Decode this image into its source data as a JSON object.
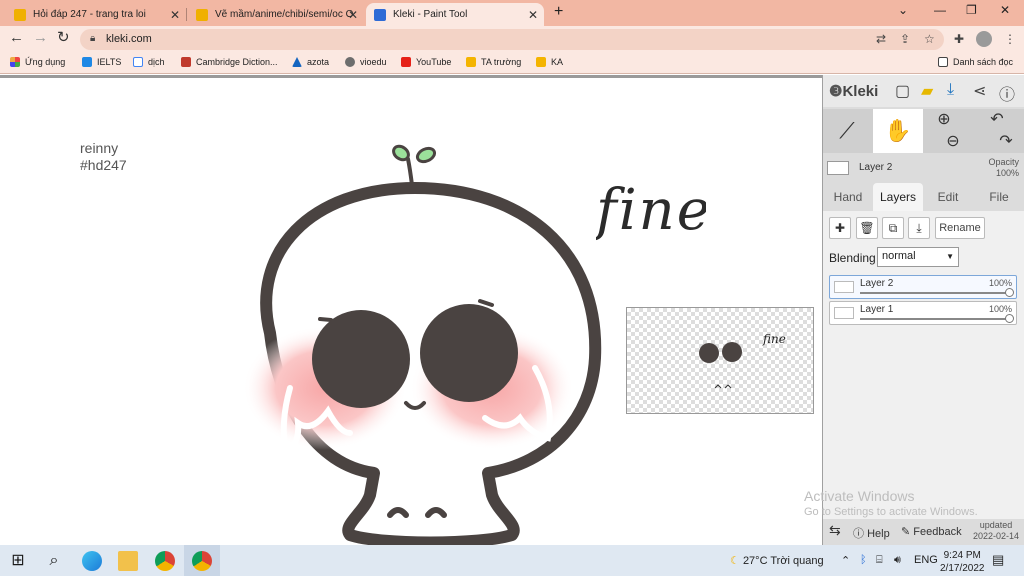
{
  "browser": {
    "tabs": [
      {
        "title": "Hỏi đáp 247 - trang tra loi",
        "active": false
      },
      {
        "title": "Vẽ mầm/anime/chibi/semi/oc O",
        "active": false
      },
      {
        "title": "Kleki - Paint Tool",
        "active": true
      }
    ],
    "new_tab": "+",
    "url": "kleki.com",
    "bookmarks": [
      "Ứng dụng",
      "IELTS",
      "dịch",
      "Cambridge Diction...",
      "azota",
      "vioedu",
      "YouTube",
      "TA trường",
      "KA"
    ],
    "reading_list": "Danh sách đọc"
  },
  "canvas": {
    "credit_line1": "reinny",
    "credit_line2": "#hd247",
    "handwriting": "fine"
  },
  "preview": {
    "handwriting": "fine"
  },
  "kleki": {
    "logo": "Kleki",
    "current_layer": "Layer 2",
    "opacity_label": "Opacity",
    "opacity_value": "100%",
    "tabs": [
      "Hand",
      "Layers",
      "Edit",
      "File"
    ],
    "rename_label": "Rename",
    "blending_label": "Blending",
    "blending_value": "normal",
    "layers": [
      {
        "name": "Layer 2",
        "opacity": "100%",
        "active": true
      },
      {
        "name": "Layer 1",
        "opacity": "100%",
        "active": false
      }
    ],
    "help": "Help",
    "feedback": "Feedback",
    "updated_label": "updated",
    "updated_date": "2022-02-14"
  },
  "watermark": {
    "line1": "Activate Windows",
    "line2": "Go to Settings to activate Windows."
  },
  "taskbar": {
    "weather": "27°C  Trời quang",
    "lang": "ENG",
    "time": "9:24 PM",
    "date": "2/17/2022"
  }
}
